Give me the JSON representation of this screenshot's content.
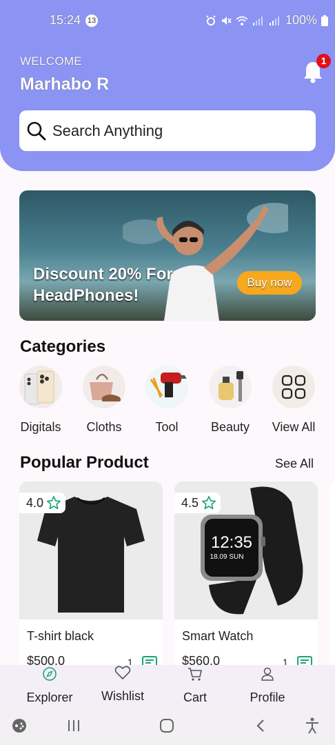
{
  "status_bar": {
    "time": "15:24",
    "notification_count": "13",
    "battery": "100%"
  },
  "header": {
    "welcome": "WELCOME",
    "username": "Marhabo R",
    "bell_badge": "1"
  },
  "search": {
    "placeholder": "Search Anything"
  },
  "banner": {
    "line1": "Discount 20% For",
    "line2": "HeadPhones!",
    "button": "Buy now"
  },
  "categories": {
    "title": "Categories",
    "items": [
      {
        "label": "Digitals",
        "icon": "phone-image"
      },
      {
        "label": "Cloths",
        "icon": "bag-shoe-image"
      },
      {
        "label": "Tool",
        "icon": "drill-image"
      },
      {
        "label": "Beauty",
        "icon": "perfume-razor-image"
      },
      {
        "label": "View All",
        "icon": "grid-icon"
      }
    ]
  },
  "popular": {
    "title": "Popular Product",
    "see_all": "See All",
    "products": [
      {
        "rating": "4.0",
        "name": "T-shirt black",
        "price": "$500.0",
        "qty": "1"
      },
      {
        "rating": "4.5",
        "name": "Smart Watch",
        "price": "$560.0",
        "qty": "1",
        "watch_time": "12:35",
        "watch_date": "18.09 SUN"
      }
    ]
  },
  "bottom_nav": {
    "items": [
      {
        "label": "Explorer",
        "icon": "compass-icon",
        "active": true
      },
      {
        "label": "Wishlist",
        "icon": "heart-icon"
      },
      {
        "label": "Cart",
        "icon": "cart-icon"
      },
      {
        "label": "Profile",
        "icon": "user-icon"
      }
    ]
  },
  "colors": {
    "header": "#8b93f3",
    "accent_green": "#1aa37a",
    "buy_button": "#f7a81c",
    "badge": "#e0101a"
  }
}
